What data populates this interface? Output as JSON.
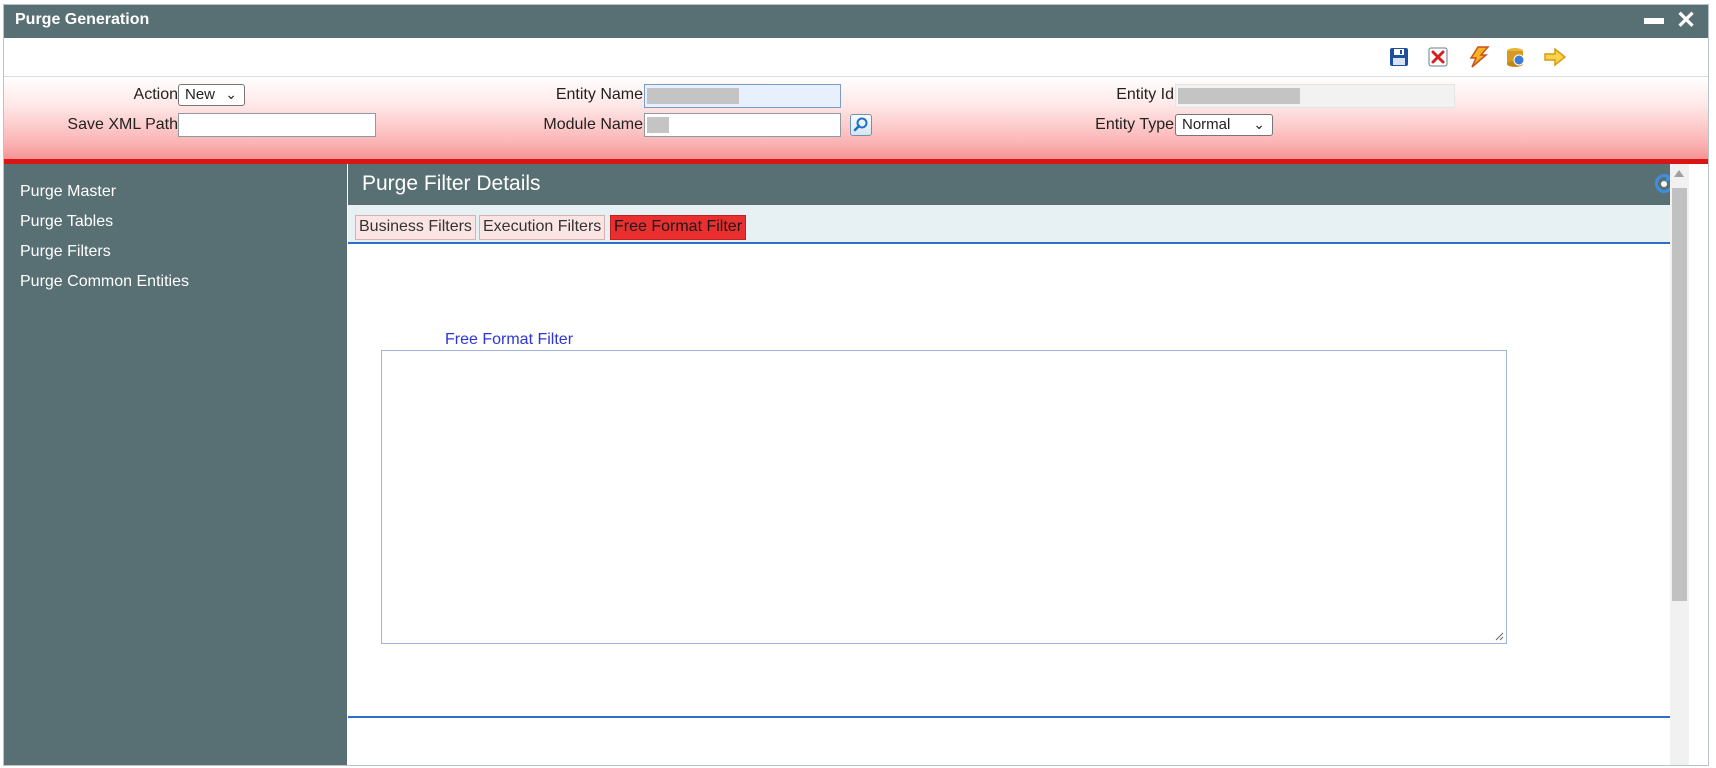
{
  "window": {
    "title": "Purge Generation"
  },
  "toolbar": {
    "icons": [
      "save-icon",
      "delete-icon",
      "generate-icon",
      "deploy-icon",
      "exit-icon"
    ]
  },
  "header": {
    "action": {
      "label": "Action",
      "value": "New"
    },
    "save_xml_path": {
      "label": "Save XML Path",
      "value": ""
    },
    "entity_name": {
      "label": "Entity Name"
    },
    "module_name": {
      "label": "Module Name"
    },
    "entity_id": {
      "label": "Entity Id"
    },
    "entity_type": {
      "label": "Entity Type",
      "value": "Normal"
    }
  },
  "sidebar": {
    "items": [
      {
        "label": "Purge Master"
      },
      {
        "label": "Purge Tables"
      },
      {
        "label": "Purge Filters"
      },
      {
        "label": "Purge Common Entities"
      }
    ]
  },
  "panel": {
    "title": "Purge Filter Details",
    "tabs": [
      {
        "label": "Business Filters",
        "active": false
      },
      {
        "label": "Execution Filters",
        "active": false
      },
      {
        "label": "Free Format Filter",
        "active": true
      }
    ],
    "free_format_filter": {
      "label": "Free Format Filter",
      "value": ""
    }
  },
  "colors": {
    "titlebar": "#587074",
    "accent_red": "#d91515",
    "active_tab": "#e92f2f",
    "link_blue": "#2f35d6",
    "divider_blue": "#2c6fc9"
  }
}
